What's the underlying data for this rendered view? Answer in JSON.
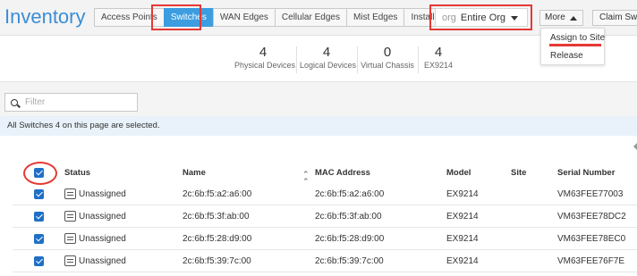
{
  "header": {
    "title": "Inventory",
    "tabs": [
      {
        "label": "Access Points"
      },
      {
        "label": "Switches"
      },
      {
        "label": "WAN Edges"
      },
      {
        "label": "Cellular Edges"
      },
      {
        "label": "Mist Edges"
      },
      {
        "label": "Installed Base"
      }
    ],
    "active_tab": "Switches",
    "org_selector": {
      "prefix": "org",
      "value": "Entire Org"
    },
    "more_label": "More",
    "claim_label": "Claim Switches",
    "more_menu": [
      {
        "label": "Assign to Site"
      },
      {
        "label": "Release"
      }
    ]
  },
  "stats": [
    {
      "value": "4",
      "label": "Physical Devices"
    },
    {
      "value": "4",
      "label": "Logical Devices"
    },
    {
      "value": "0",
      "label": "Virtual Chassis"
    },
    {
      "value": "4",
      "label": "EX9214"
    }
  ],
  "filter": {
    "placeholder": "Filter",
    "value": ""
  },
  "selection_banner": {
    "prefix": "All Switches ",
    "count": "4",
    "suffix": " on this page are selected."
  },
  "table": {
    "columns": [
      "Status",
      "Name",
      "MAC Address",
      "Model",
      "Site",
      "Serial Number"
    ],
    "rows": [
      {
        "status": "Unassigned",
        "name": "2c:6b:f5:a2:a6:00",
        "mac": "2c:6b:f5:a2:a6:00",
        "model": "EX9214",
        "site": "",
        "serial": "VM63FEE77003"
      },
      {
        "status": "Unassigned",
        "name": "2c:6b:f5:3f:ab:00",
        "mac": "2c:6b:f5:3f:ab:00",
        "model": "EX9214",
        "site": "",
        "serial": "VM63FEE78DC2"
      },
      {
        "status": "Unassigned",
        "name": "2c:6b:f5:28:d9:00",
        "mac": "2c:6b:f5:28:d9:00",
        "model": "EX9214",
        "site": "",
        "serial": "VM63FEE78EC0"
      },
      {
        "status": "Unassigned",
        "name": "2c:6b:f5:39:7c:00",
        "mac": "2c:6b:f5:39:7c:00",
        "model": "EX9214",
        "site": "",
        "serial": "VM63FEE76F7E"
      }
    ]
  },
  "colors": {
    "accent": "#3c9de0",
    "title": "#3c8dd6",
    "checkbox": "#1f6fc5",
    "highlight": "#e53935",
    "banner": "#e9f2fa"
  }
}
